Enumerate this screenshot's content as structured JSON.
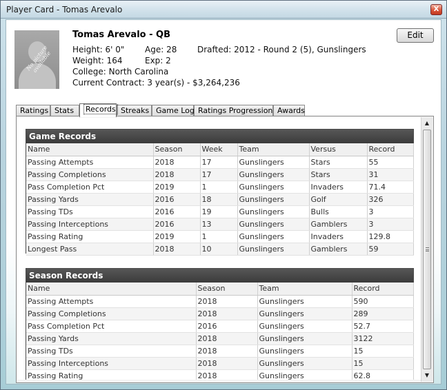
{
  "window": {
    "title": "Player Card - Tomas Arevalo",
    "close_glyph": "X"
  },
  "player": {
    "name": "Tomas Arevalo - QB",
    "photo_text": "No picture available",
    "height": "Height: 6' 0\"",
    "age": "Age: 28",
    "drafted": "Drafted: 2012 - Round 2 (5), Gunslingers",
    "weight": "Weight: 164",
    "exp": "Exp: 2",
    "college": "College: North Carolina",
    "contract": "Current Contract: 3 year(s) - $3,264,236"
  },
  "edit_label": "Edit",
  "tabs": [
    {
      "label": "Ratings"
    },
    {
      "label": "Stats"
    },
    {
      "label": "Records"
    },
    {
      "label": "Streaks"
    },
    {
      "label": "Game Log"
    },
    {
      "label": "Ratings Progression"
    },
    {
      "label": "Awards"
    }
  ],
  "active_tab": "Records",
  "game_records": {
    "title": "Game Records",
    "columns": [
      "Name",
      "Season",
      "Week",
      "Team",
      "Versus",
      "Record"
    ],
    "rows": [
      [
        "Passing Attempts",
        "2018",
        "17",
        "Gunslingers",
        "Stars",
        "55"
      ],
      [
        "Passing Completions",
        "2018",
        "17",
        "Gunslingers",
        "Stars",
        "31"
      ],
      [
        "Pass Completion Pct",
        "2019",
        "1",
        "Gunslingers",
        "Invaders",
        "71.4"
      ],
      [
        "Passing Yards",
        "2016",
        "18",
        "Gunslingers",
        "Golf",
        "326"
      ],
      [
        "Passing TDs",
        "2016",
        "19",
        "Gunslingers",
        "Bulls",
        "3"
      ],
      [
        "Passing Interceptions",
        "2016",
        "13",
        "Gunslingers",
        "Gamblers",
        "3"
      ],
      [
        "Passing Rating",
        "2019",
        "1",
        "Gunslingers",
        "Invaders",
        "129.8"
      ],
      [
        "Longest Pass",
        "2018",
        "10",
        "Gunslingers",
        "Gamblers",
        "59"
      ]
    ]
  },
  "season_records": {
    "title": "Season Records",
    "columns": [
      "Name",
      "Season",
      "Team",
      "Record"
    ],
    "rows": [
      [
        "Passing Attempts",
        "2018",
        "Gunslingers",
        "590"
      ],
      [
        "Passing Completions",
        "2018",
        "Gunslingers",
        "289"
      ],
      [
        "Pass Completion Pct",
        "2016",
        "Gunslingers",
        "52.7"
      ],
      [
        "Passing Yards",
        "2018",
        "Gunslingers",
        "3122"
      ],
      [
        "Passing TDs",
        "2018",
        "Gunslingers",
        "15"
      ],
      [
        "Passing Interceptions",
        "2018",
        "Gunslingers",
        "15"
      ],
      [
        "Passing Rating",
        "2018",
        "Gunslingers",
        "62.8"
      ]
    ]
  },
  "scrollbar": {
    "up_glyph": "▲",
    "down_glyph": "▼"
  }
}
